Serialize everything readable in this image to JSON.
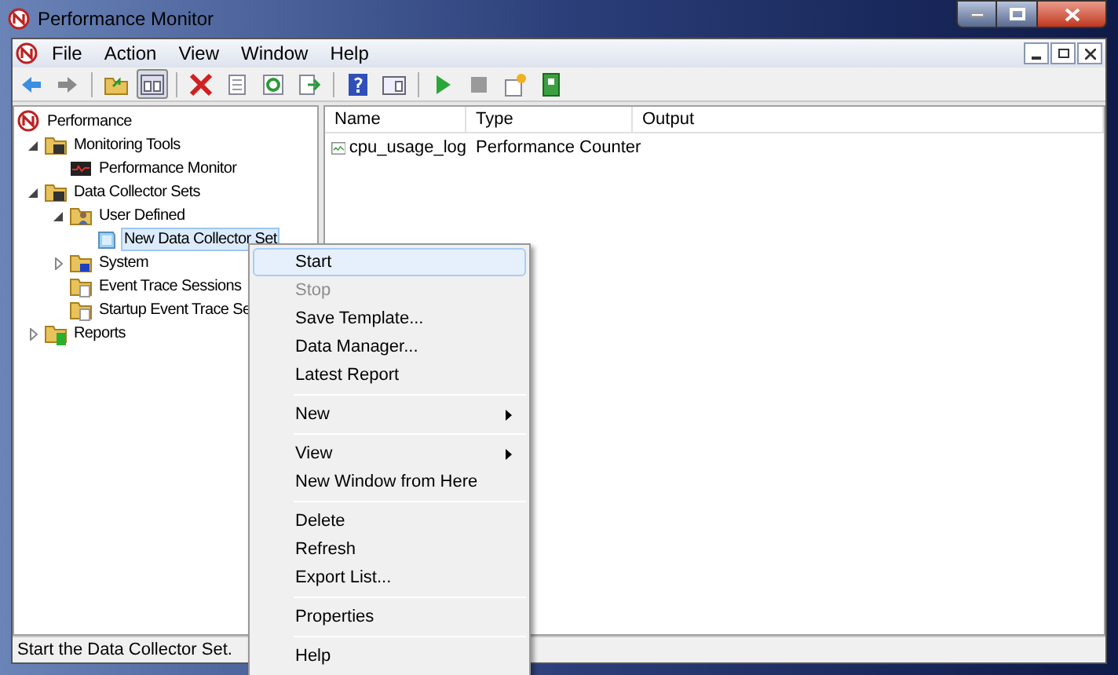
{
  "window": {
    "title": "Performance Monitor"
  },
  "menu_bar": [
    "File",
    "Action",
    "View",
    "Window",
    "Help"
  ],
  "tree": [
    {
      "label": "Performance",
      "kind": "root",
      "selected": false,
      "children": [
        {
          "label": "Monitoring Tools",
          "kind": "folder",
          "expanded": true,
          "selected": false,
          "children": [
            {
              "label": "Performance Monitor",
              "kind": "monitor",
              "selected": false
            }
          ]
        },
        {
          "label": "Data Collector Sets",
          "kind": "folder",
          "expanded": true,
          "selected": false,
          "children": [
            {
              "label": "User Defined",
              "kind": "userfolder",
              "expanded": true,
              "selected": false,
              "children": [
                {
                  "label": "New Data Collector Set",
                  "kind": "set",
                  "selected": true
                }
              ]
            },
            {
              "label": "System",
              "kind": "sysfolder",
              "expanded": false,
              "selected": false
            },
            {
              "label": "Event Trace Sessions",
              "kind": "tracefolder",
              "selected": false
            },
            {
              "label": "Startup Event Trace Se",
              "kind": "tracefolder",
              "selected": false
            }
          ]
        },
        {
          "label": "Reports",
          "kind": "reports",
          "expanded": false,
          "selected": false
        }
      ]
    }
  ],
  "list": {
    "columns": [
      "Name",
      "Type",
      "Output"
    ],
    "rows": [
      {
        "name": "cpu_usage_log",
        "type": "Performance Counter"
      }
    ]
  },
  "context_menu": [
    {
      "kind": "item",
      "label": "Start",
      "selected": true,
      "disabled": false
    },
    {
      "kind": "item",
      "label": "Stop",
      "selected": false,
      "disabled": true
    },
    {
      "kind": "item",
      "label": "Save Template...",
      "selected": false,
      "disabled": false
    },
    {
      "kind": "item",
      "label": "Data Manager...",
      "selected": false,
      "disabled": false
    },
    {
      "kind": "item",
      "label": "Latest Report",
      "selected": false,
      "disabled": false
    },
    {
      "kind": "separator"
    },
    {
      "kind": "submenu",
      "label": "New",
      "selected": false,
      "disabled": false
    },
    {
      "kind": "separator"
    },
    {
      "kind": "submenu",
      "label": "View",
      "selected": false,
      "disabled": false
    },
    {
      "kind": "item",
      "label": "New Window from Here",
      "selected": false,
      "disabled": false
    },
    {
      "kind": "separator"
    },
    {
      "kind": "item",
      "label": "Delete",
      "selected": false,
      "disabled": false
    },
    {
      "kind": "item",
      "label": "Refresh",
      "selected": false,
      "disabled": false
    },
    {
      "kind": "item",
      "label": "Export List...",
      "selected": false,
      "disabled": false
    },
    {
      "kind": "separator"
    },
    {
      "kind": "item",
      "label": "Properties",
      "selected": false,
      "disabled": false
    },
    {
      "kind": "separator"
    },
    {
      "kind": "item",
      "label": "Help",
      "selected": false,
      "disabled": false
    }
  ],
  "status_bar": "Start the Data Collector Set."
}
